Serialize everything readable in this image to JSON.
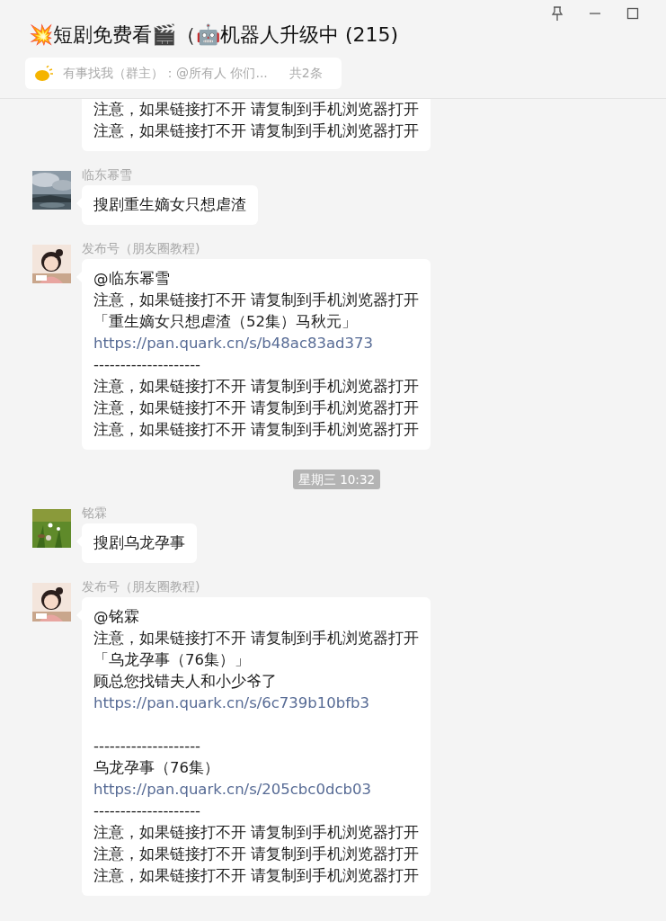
{
  "window": {
    "title": "💥短剧免费看🎬（🤖机器人升级中 (215)"
  },
  "notice": {
    "text": "有事找我（群主）：@所有人 你们...",
    "count": "共2条"
  },
  "messages": [
    {
      "kind": "message",
      "lines": [
        {
          "kind": "text",
          "text": "注意，如果链接打不开 请复制到手机浏览器打开"
        },
        {
          "kind": "text",
          "text": "注意，如果链接打不开 请复制到手机浏览器打开"
        }
      ]
    },
    {
      "kind": "message",
      "sender": "临东幂雪",
      "avatar": {
        "kind": "picture"
      },
      "lines": [
        {
          "kind": "text",
          "text": "搜剧重生嫡女只想虐渣"
        }
      ]
    },
    {
      "kind": "message",
      "sender": "发布号（朋友圈教程)",
      "avatar": {
        "kind": "picture"
      },
      "lines": [
        {
          "kind": "text",
          "text": "@临东幂雪"
        },
        {
          "kind": "text",
          "text": "注意，如果链接打不开 请复制到手机浏览器打开"
        },
        {
          "kind": "text",
          "text": "「重生嫡女只想虐渣（52集）马秋元」"
        },
        {
          "kind": "link",
          "text": "https://pan.quark.cn/s/b48ac83ad373"
        },
        {
          "kind": "text",
          "text": "--------------------"
        },
        {
          "kind": "text",
          "text": "注意，如果链接打不开 请复制到手机浏览器打开"
        },
        {
          "kind": "text",
          "text": "注意，如果链接打不开 请复制到手机浏览器打开"
        },
        {
          "kind": "text",
          "text": "注意，如果链接打不开 请复制到手机浏览器打开"
        }
      ]
    },
    {
      "kind": "time",
      "text": "星期三 10:32"
    },
    {
      "kind": "message",
      "sender": "铭霖",
      "avatar": {
        "kind": "picture"
      },
      "lines": [
        {
          "kind": "text",
          "text": "搜剧乌龙孕事"
        }
      ]
    },
    {
      "kind": "message",
      "sender": "发布号（朋友圈教程)",
      "avatar": {
        "kind": "picture"
      },
      "lines": [
        {
          "kind": "text",
          "text": "@铭霖"
        },
        {
          "kind": "text",
          "text": "注意，如果链接打不开 请复制到手机浏览器打开"
        },
        {
          "kind": "text",
          "text": "「乌龙孕事（76集）」"
        },
        {
          "kind": "text",
          "text": "顾总您找错夫人和小少爷了"
        },
        {
          "kind": "link",
          "text": "https://pan.quark.cn/s/6c739b10bfb3"
        },
        {
          "kind": "blank"
        },
        {
          "kind": "text",
          "text": "--------------------"
        },
        {
          "kind": "text",
          "text": "乌龙孕事（76集）"
        },
        {
          "kind": "link",
          "text": "https://pan.quark.cn/s/205cbc0dcb03"
        },
        {
          "kind": "text",
          "text": "--------------------"
        },
        {
          "kind": "text",
          "text": "注意，如果链接打不开 请复制到手机浏览器打开"
        },
        {
          "kind": "text",
          "text": "注意，如果链接打不开 请复制到手机浏览器打开"
        },
        {
          "kind": "text",
          "text": "注意，如果链接打不开 请复制到手机浏览器打开"
        }
      ]
    }
  ]
}
